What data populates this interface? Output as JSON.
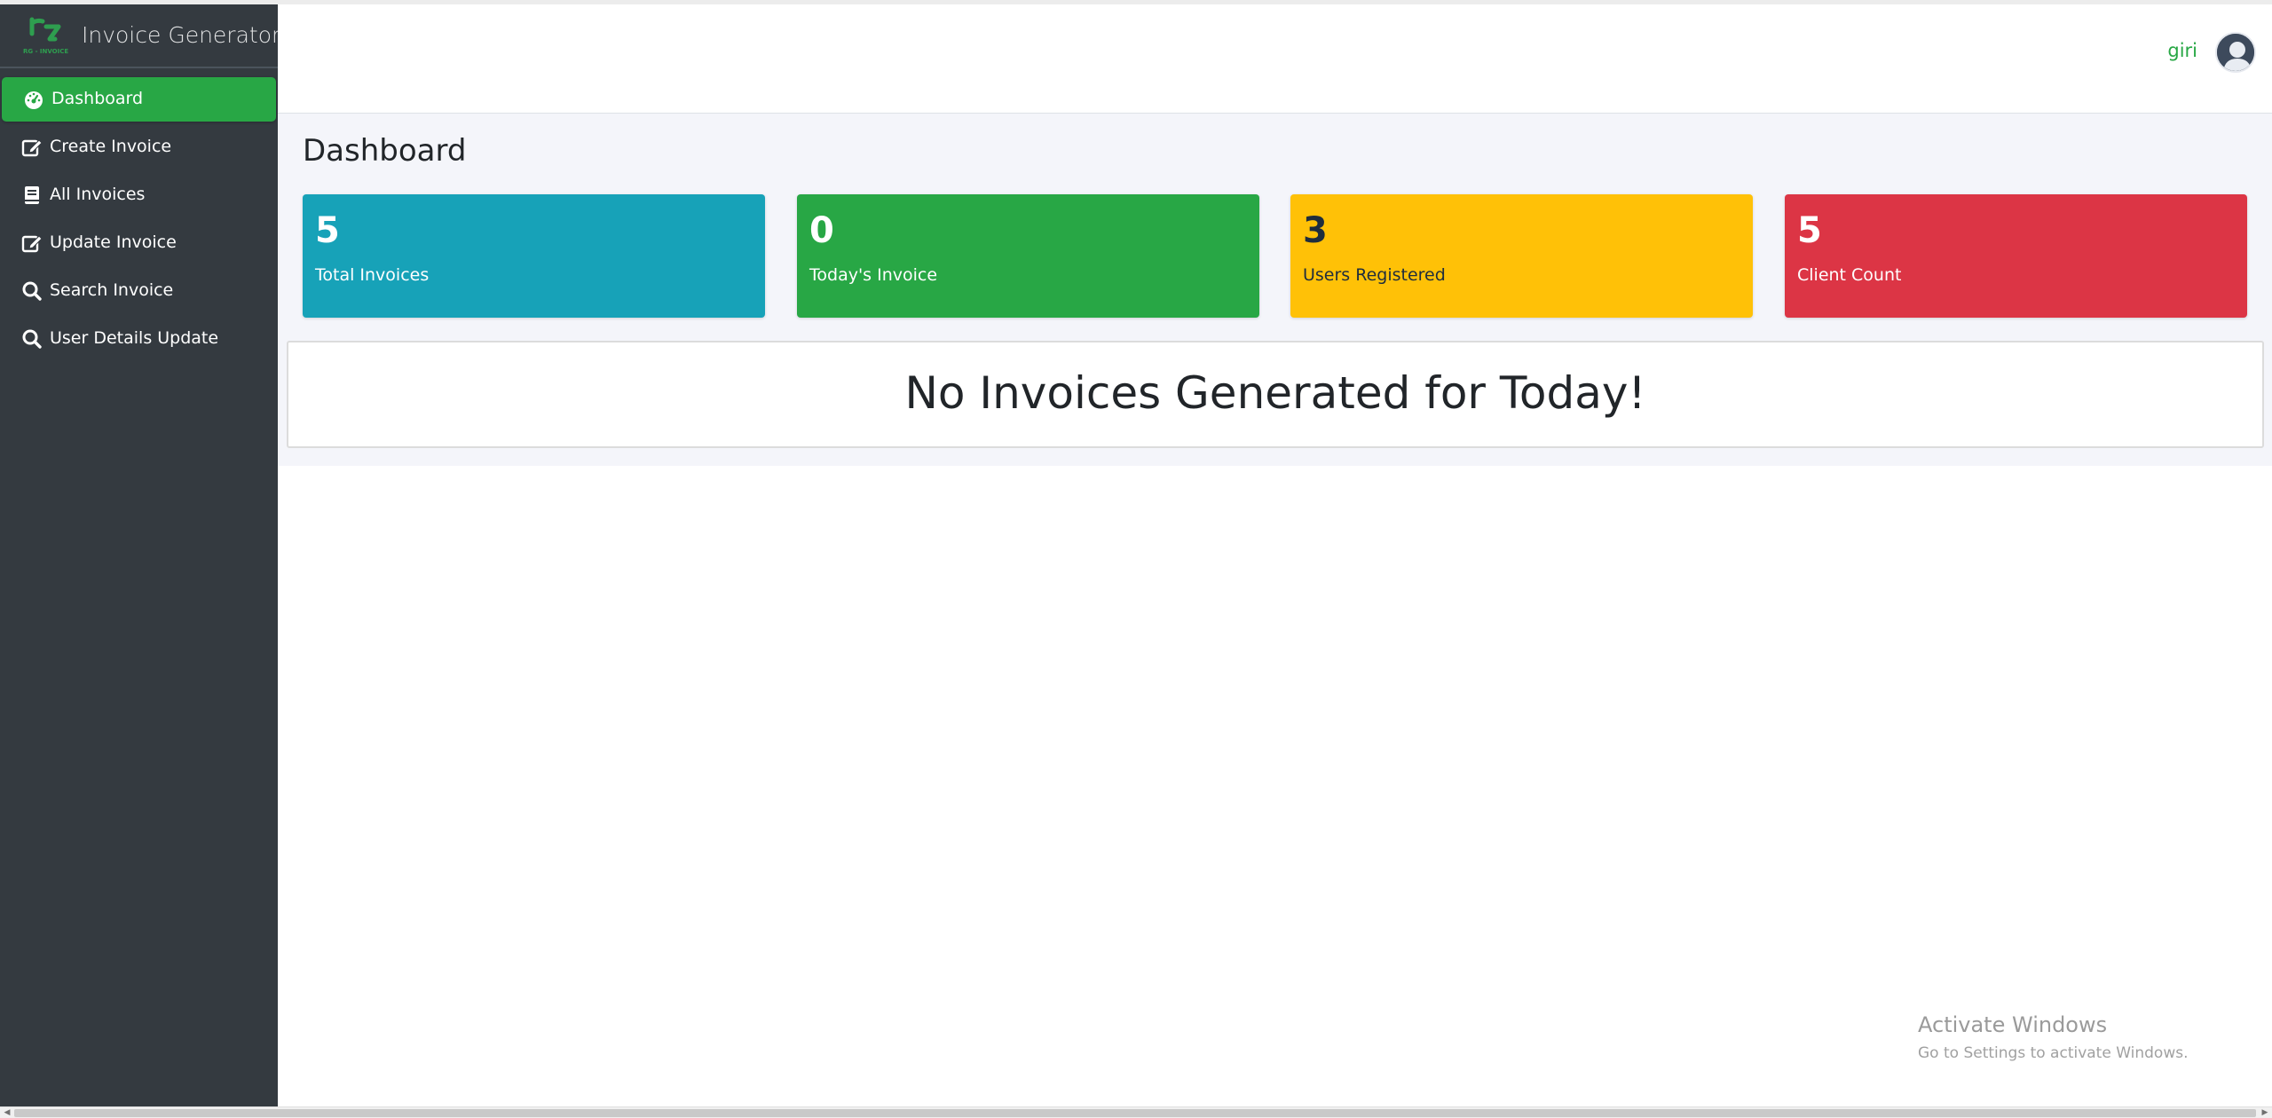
{
  "app": {
    "title": "Invoice Generator",
    "logo_caption": "RG - INVOICE"
  },
  "sidebar": {
    "items": [
      {
        "label": "Dashboard",
        "icon": "tachometer-icon",
        "active": true
      },
      {
        "label": "Create Invoice",
        "icon": "edit-icon",
        "active": false
      },
      {
        "label": "All Invoices",
        "icon": "book-icon",
        "active": false
      },
      {
        "label": "Update Invoice",
        "icon": "edit-icon",
        "active": false
      },
      {
        "label": "Search Invoice",
        "icon": "search-icon",
        "active": false
      },
      {
        "label": "User Details Update",
        "icon": "search-icon",
        "active": false
      }
    ]
  },
  "header": {
    "username": "giri",
    "avatar_icon": "user-avatar-icon"
  },
  "main": {
    "title": "Dashboard",
    "stats": [
      {
        "value": "5",
        "label": "Total Invoices",
        "color": "#17a2b8"
      },
      {
        "value": "0",
        "label": "Today's Invoice",
        "color": "#28a745"
      },
      {
        "value": "3",
        "label": "Users Registered",
        "color": "#ffc107"
      },
      {
        "value": "5",
        "label": "Client Count",
        "color": "#dc3545"
      }
    ],
    "notice": "No Invoices Generated for Today!"
  },
  "watermark": {
    "title": "Activate Windows",
    "subtitle": "Go to Settings to activate Windows."
  },
  "colors": {
    "sidebar_bg": "#343a40",
    "accent": "#28a745",
    "main_bg": "#f4f5fa"
  }
}
